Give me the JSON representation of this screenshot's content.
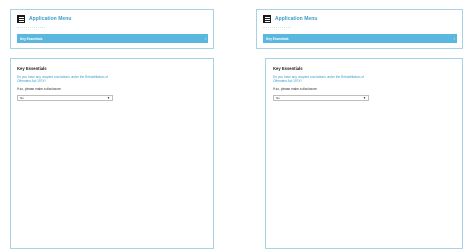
{
  "panes": [
    {
      "menu": {
        "icon": "hamburger-menu-icon",
        "title": "Application Menu",
        "accordion_label": "Key Essentials",
        "accordion_chevron": "›"
      },
      "form": {
        "section_title": "Key Essentials",
        "question": "Do you have any unspent convictions under the Rehabilitation of Offenders Act 1974?",
        "note": "If so, please make a disclosure.",
        "select_value": "No"
      }
    },
    {
      "menu": {
        "icon": "hamburger-menu-icon",
        "title": "Application Menu",
        "accordion_label": "Key Essentials",
        "accordion_chevron": "›"
      },
      "form": {
        "section_title": "Key Essentials",
        "question": "Do you have any unspent convictions under the Rehabilitation of Offenders Act 1974?",
        "note": "If so, please make a disclosure.",
        "select_value": "No"
      }
    }
  ],
  "colors": {
    "accent": "#3a9ccb",
    "accordion_bg": "#5ab8de",
    "panel_border": "#a8d3e6"
  }
}
